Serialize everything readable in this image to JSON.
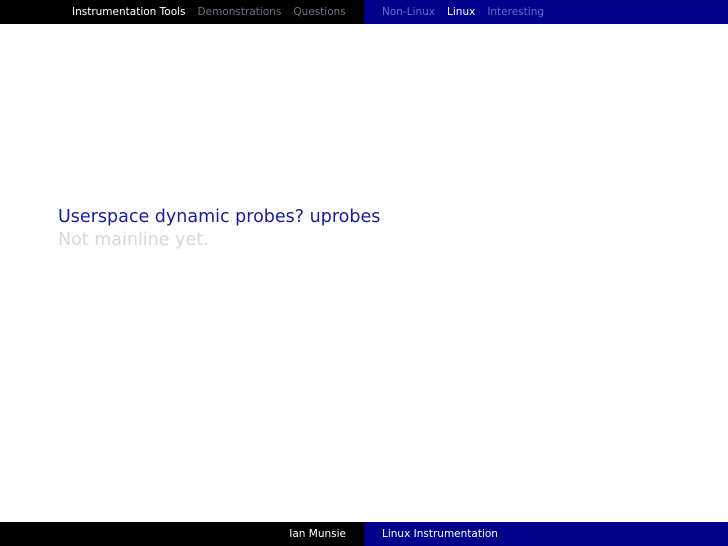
{
  "header": {
    "sections_left": [
      {
        "label": "Instrumentation Tools",
        "active": true
      },
      {
        "label": "Demonstrations",
        "active": false
      },
      {
        "label": "Questions",
        "active": false
      }
    ],
    "sections_right": [
      {
        "label": "Non-Linux",
        "active": false
      },
      {
        "label": "Linux",
        "active": true
      },
      {
        "label": "Interesting",
        "active": false
      }
    ]
  },
  "slide": {
    "line1": "Userspace dynamic probes? uprobes",
    "line2": "Not mainline yet."
  },
  "footer": {
    "author": "Ian Munsie",
    "title": "Linux Instrumentation"
  },
  "colors": {
    "bar_black": "#000000",
    "bar_blue": "#00008c",
    "text_blue": "#1a1a9a",
    "text_faded": "#d8d8d8"
  }
}
